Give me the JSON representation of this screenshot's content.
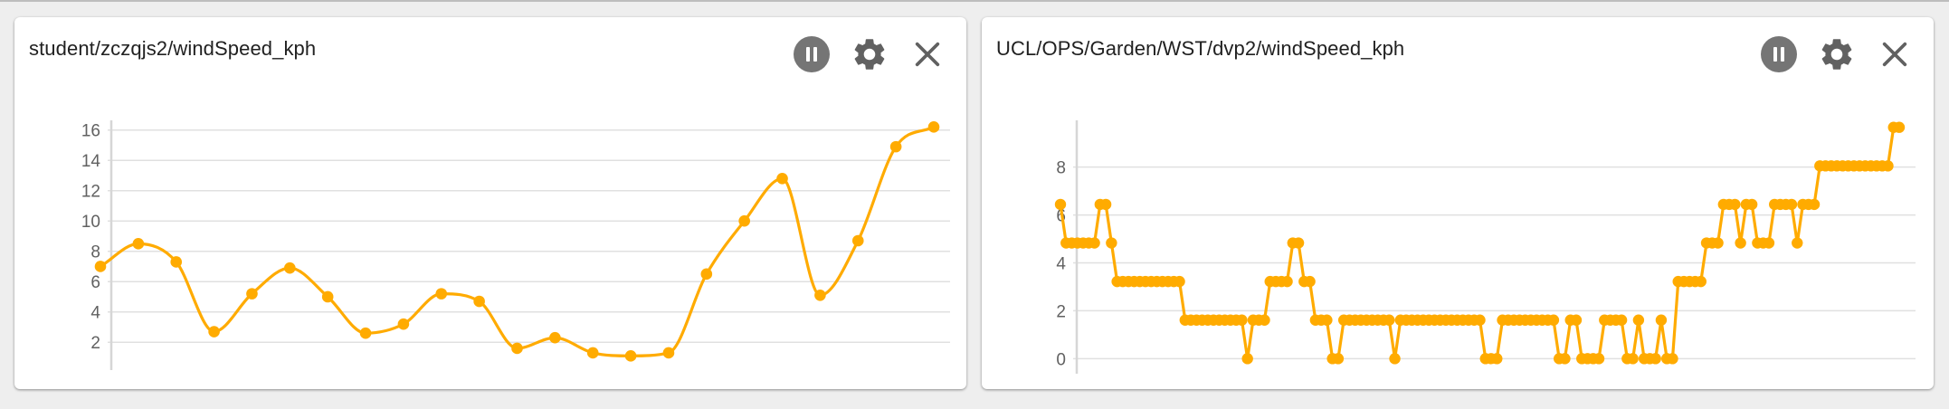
{
  "colors": {
    "line": "#FFAB00",
    "grid": "#e0e0e0",
    "axis": "#d6d6d6",
    "icon": "#616161",
    "pause_bg": "#757575"
  },
  "panels": [
    {
      "title": "student/zczqjs2/windSpeed_kph",
      "actions": {
        "pause_icon": "pause-icon",
        "settings_icon": "gear-icon",
        "close_icon": "close-icon"
      }
    },
    {
      "title": "UCL/OPS/Garden/WST/dvp2/windSpeed_kph",
      "actions": {
        "pause_icon": "pause-icon",
        "settings_icon": "gear-icon",
        "close_icon": "close-icon"
      }
    }
  ],
  "chart_data": [
    {
      "type": "line",
      "curve": "smooth",
      "title": "student/zczqjs2/windSpeed_kph",
      "xlabel": "",
      "ylabel": "",
      "ylim": [
        1,
        16.4
      ],
      "yticks": [
        2,
        4,
        6,
        8,
        10,
        12,
        14,
        16
      ],
      "grid": true,
      "legend": "none",
      "series": [
        {
          "values": [
            7.0,
            8.5,
            7.3,
            2.7,
            5.2,
            6.9,
            5.0,
            2.6,
            3.2,
            5.2,
            4.7,
            1.6,
            2.3,
            1.3,
            1.1,
            1.3,
            6.5,
            10.0,
            12.8,
            5.1,
            8.7,
            14.9,
            16.2
          ]
        }
      ]
    },
    {
      "type": "line",
      "curve": "linear",
      "title": "UCL/OPS/Garden/WST/dvp2/windSpeed_kph",
      "xlabel": "",
      "ylabel": "",
      "ylim": [
        -0.1,
        9.8
      ],
      "yticks": [
        0,
        2,
        4,
        6,
        8
      ],
      "grid": true,
      "legend": "none",
      "series": [
        {
          "values": [
            6.44,
            4.83,
            4.83,
            4.83,
            4.83,
            4.83,
            4.83,
            6.44,
            6.44,
            4.83,
            3.22,
            3.22,
            3.22,
            3.22,
            3.22,
            3.22,
            3.22,
            3.22,
            3.22,
            3.22,
            3.22,
            3.22,
            1.61,
            1.61,
            1.61,
            1.61,
            1.61,
            1.61,
            1.61,
            1.61,
            1.61,
            1.61,
            1.61,
            0,
            1.61,
            1.61,
            1.61,
            3.22,
            3.22,
            3.22,
            3.22,
            4.83,
            4.83,
            3.22,
            3.22,
            1.61,
            1.61,
            1.61,
            0,
            0,
            1.61,
            1.61,
            1.61,
            1.61,
            1.61,
            1.61,
            1.61,
            1.61,
            1.61,
            0,
            1.61,
            1.61,
            1.61,
            1.61,
            1.61,
            1.61,
            1.61,
            1.61,
            1.61,
            1.61,
            1.61,
            1.61,
            1.61,
            1.61,
            1.61,
            0,
            0,
            0,
            1.61,
            1.61,
            1.61,
            1.61,
            1.61,
            1.61,
            1.61,
            1.61,
            1.61,
            1.61,
            0,
            0,
            1.61,
            1.61,
            0,
            0,
            0,
            0,
            1.61,
            1.61,
            1.61,
            1.61,
            0,
            0,
            1.61,
            0,
            0,
            0,
            1.61,
            0,
            0,
            3.22,
            3.22,
            3.22,
            3.22,
            3.22,
            4.83,
            4.83,
            4.83,
            6.44,
            6.44,
            6.44,
            4.83,
            6.44,
            6.44,
            4.83,
            4.83,
            4.83,
            6.44,
            6.44,
            6.44,
            6.44,
            4.83,
            6.44,
            6.44,
            6.44,
            8.05,
            8.05,
            8.05,
            8.05,
            8.05,
            8.05,
            8.05,
            8.05,
            8.05,
            8.05,
            8.05,
            8.05,
            8.05,
            9.66,
            9.66
          ]
        }
      ]
    }
  ]
}
